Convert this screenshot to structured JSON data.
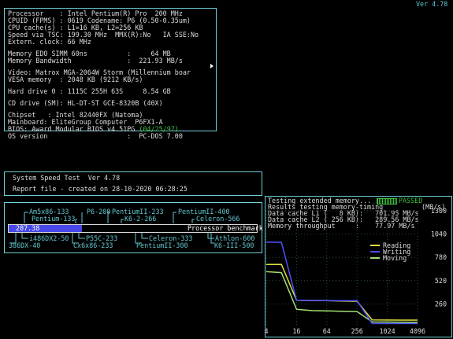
{
  "version": "Ver 4.78",
  "sysinfo": {
    "lines": [
      "Processor    : Intel Pentium(R) Pro  200 MHz",
      "CPUID (FPMS) : 0619 Codename: P6 (0.50-0.35um)",
      "CPU cache(s) : L1=16 KB, L2=256 KB",
      "Speed via TSC: 199.30 MHz  MMX(R):No   IA SSE:No",
      "Extern. clock: 66 MHz",
      "",
      "Memory EDO SIMM 60ns          :     64 MB",
      "Memory Bandwidth              :  221.93 MB/s",
      "",
      "Video: Matrox MGA-2064W Storm (Millennium boar",
      "VESA memory  : 2048 KB (9212 KB/s)",
      "",
      "Hard drive 0 : 1115C 255H 63S     8.54 GB",
      "",
      "CD drive (SM): HL-DT-ST GCE-8320B (40X)",
      "",
      "Chipset   : Intel 82440FX (Natoma)",
      "Mainboard: EliteGroup Computer  P6FX1-A",
      "BIOS: Award Modular BIOS v4.51PG",
      "OS version                    :  PC-DOS 7.00"
    ],
    "bios_date": "(04/25/97)"
  },
  "speedtest": {
    "title": "System Speed Test  Ver 4.78",
    "report": "Report file - created on 28-10-2020 06:28:25"
  },
  "benchmark": {
    "score": "207.38",
    "caption": "Processor benchmark",
    "top_labels": [
      "Am5x86-133",
      "P6-200",
      "PentiumII-233",
      "PentiumII-400",
      "Pentium-133",
      "K6-2-266",
      "Celeron-566"
    ],
    "bottom_labels": [
      "i486DX2-50",
      "P55C-233",
      "Celeron-333",
      "Athlon-600",
      "386DX-40",
      "Cx6x86-233",
      "PentiumII-300",
      "K6-III-500"
    ]
  },
  "memtest": {
    "line1": "Testing extended memory...",
    "status": "PASSED",
    "line2": "Results testing memory-timing",
    "units": "(MB/s)",
    "l1": "Data cache L1 (   8 KB):   701.95 MB/s",
    "l2": "Data cache L2 ( 256 KB):   289.56 MB/s",
    "mem": "Memory throughput     :    77.97 MB/s",
    "y_ticks": [
      "1300",
      "1040",
      "780",
      "520",
      "260"
    ],
    "x_ticks": [
      "4",
      "16",
      "64",
      "256",
      "1024",
      "4096"
    ],
    "legend": [
      {
        "name": "Reading",
        "color": "#e0e040"
      },
      {
        "name": "Writing",
        "color": "#5050ff"
      },
      {
        "name": "Moving",
        "color": "#a0e070"
      }
    ]
  },
  "chart_data": {
    "type": "line",
    "ylabel": "(MB/s)",
    "ylim": [
      0,
      1300
    ],
    "x": [
      4,
      8,
      16,
      32,
      64,
      128,
      256,
      512,
      1024,
      2048,
      4096
    ],
    "series": [
      {
        "name": "Reading",
        "values": [
          700,
          702,
          300,
          298,
          296,
          292,
          290,
          82,
          80,
          79,
          79
        ]
      },
      {
        "name": "Writing",
        "values": [
          950,
          948,
          300,
          299,
          298,
          297,
          296,
          40,
          40,
          40,
          40
        ]
      },
      {
        "name": "Moving",
        "values": [
          620,
          610,
          200,
          185,
          182,
          178,
          175,
          60,
          58,
          56,
          55
        ]
      }
    ]
  }
}
